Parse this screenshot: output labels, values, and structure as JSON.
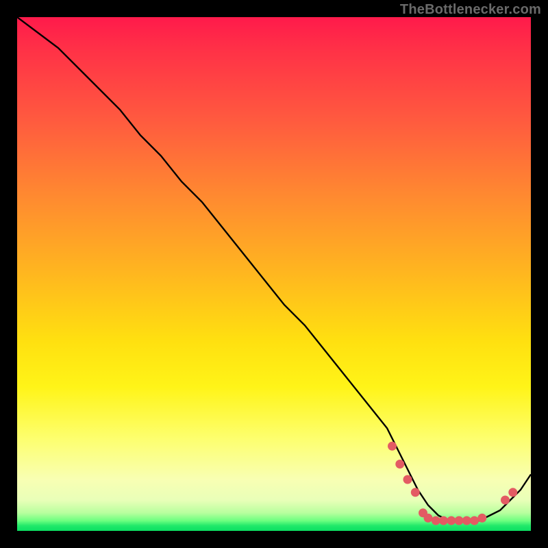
{
  "watermark": "TheBottlenecker.com",
  "colors": {
    "curve": "#000000",
    "dot_fill": "#e35b63",
    "dot_stroke": "#c44a52",
    "bg_black": "#000000"
  },
  "chart_data": {
    "type": "line",
    "title": "",
    "xlabel": "",
    "ylabel": "",
    "xlim": [
      0,
      100
    ],
    "ylim": [
      0,
      100
    ],
    "grid": false,
    "legend": false,
    "series": [
      {
        "name": "bottleneck-curve",
        "x": [
          0,
          4,
          8,
          12,
          16,
          20,
          24,
          28,
          32,
          36,
          40,
          44,
          48,
          52,
          56,
          60,
          64,
          68,
          72,
          74,
          76,
          78,
          80,
          82,
          84,
          86,
          88,
          90,
          92,
          94,
          96,
          98,
          100
        ],
        "y": [
          100,
          97,
          94,
          90,
          86,
          82,
          77,
          73,
          68,
          64,
          59,
          54,
          49,
          44,
          40,
          35,
          30,
          25,
          20,
          16,
          12,
          8,
          5,
          3,
          2,
          2,
          2,
          2,
          3,
          4,
          6,
          8,
          11
        ]
      }
    ],
    "dots": [
      {
        "x": 73,
        "y": 16.5
      },
      {
        "x": 74.5,
        "y": 13
      },
      {
        "x": 76,
        "y": 10
      },
      {
        "x": 77.5,
        "y": 7.5
      },
      {
        "x": 79,
        "y": 3.5
      },
      {
        "x": 80,
        "y": 2.5
      },
      {
        "x": 81.5,
        "y": 2
      },
      {
        "x": 83,
        "y": 2
      },
      {
        "x": 84.5,
        "y": 2
      },
      {
        "x": 86,
        "y": 2
      },
      {
        "x": 87.5,
        "y": 2
      },
      {
        "x": 89,
        "y": 2
      },
      {
        "x": 90.5,
        "y": 2.5
      },
      {
        "x": 95,
        "y": 6
      },
      {
        "x": 96.5,
        "y": 7.5
      }
    ]
  }
}
